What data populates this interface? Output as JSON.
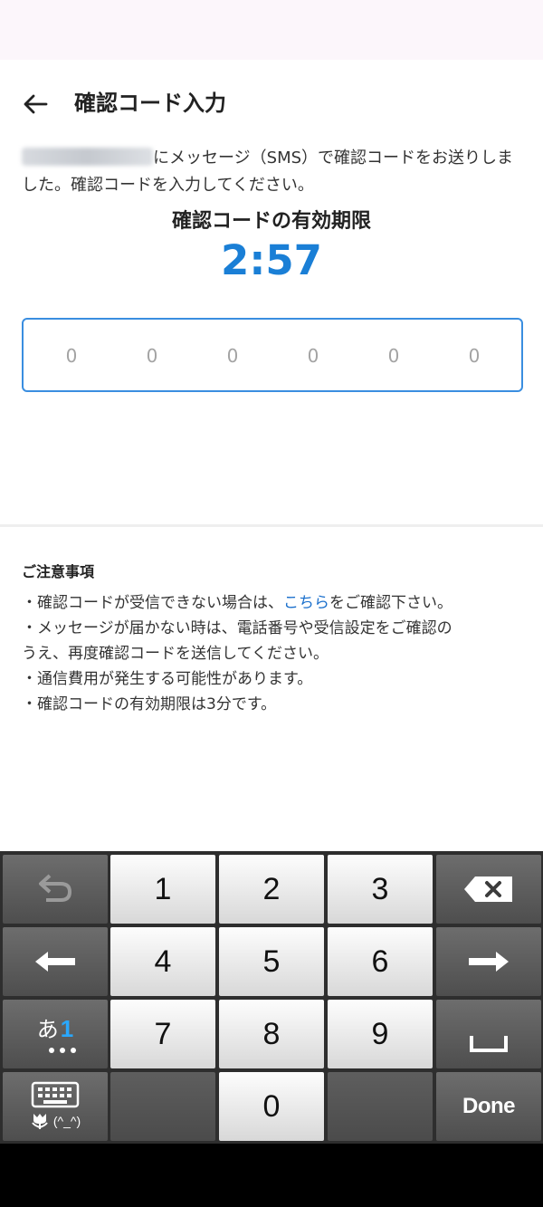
{
  "header": {
    "title": "確認コード入力"
  },
  "message": {
    "text": "にメッセージ（SMS）で確認コードをお送りしました。確認コードを入力してください。"
  },
  "expiry": {
    "label": "確認コードの有効期限",
    "timer": "2:57"
  },
  "code_input": {
    "placeholders": [
      "0",
      "0",
      "0",
      "0",
      "0",
      "0"
    ]
  },
  "notes": {
    "title": "ご注意事項",
    "item1_prefix": "・確認コードが受信できない場合は、",
    "item1_link": "こちら",
    "item1_suffix": "をご確認下さい。",
    "item2_line1": "・メッセージが届かない時は、電話番号や受信設定をご確認の",
    "item2_line2": "うえ、再度確認コードを送信してください。",
    "item3": "・通信費用が発生する可能性があります。",
    "item4": "・確認コードの有効期限は3分です。"
  },
  "keyboard": {
    "keys": [
      "1",
      "2",
      "3",
      "4",
      "5",
      "6",
      "7",
      "8",
      "9",
      "0"
    ],
    "mode_kana": "あ",
    "mode_num": "1",
    "emoticon": "(^_^)",
    "done": "Done"
  },
  "colors": {
    "accent": "#1a7fd6",
    "link": "#1a6fcc",
    "input_border": "#3a8ee0"
  }
}
